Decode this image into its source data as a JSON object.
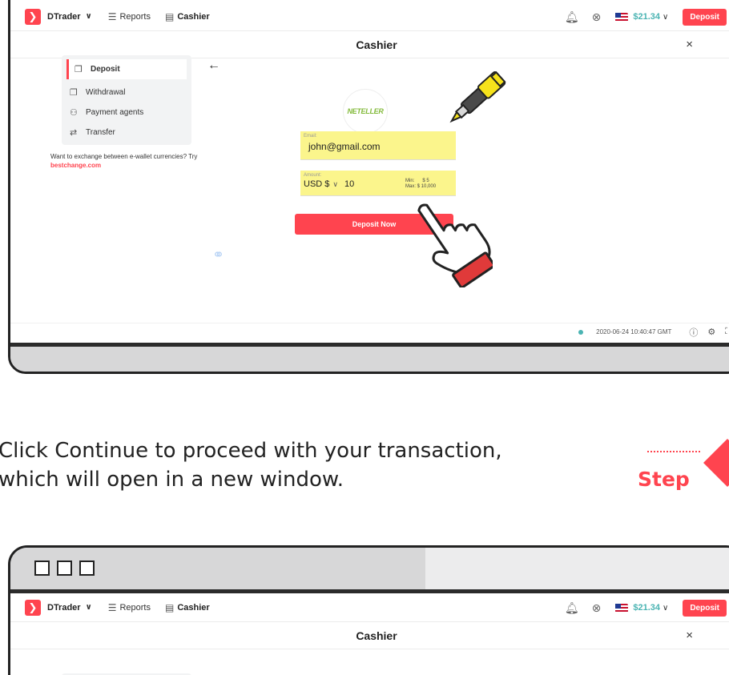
{
  "header": {
    "brand": "DTrader",
    "reports": "Reports",
    "cashier": "Cashier",
    "balance": "$21.34",
    "deposit": "Deposit",
    "chevron": "∨"
  },
  "cashier_title": "Cashier",
  "close": "×",
  "sidebar": {
    "items": [
      {
        "label": "Deposit",
        "icon": "deposit-icon"
      },
      {
        "label": "Withdrawal",
        "icon": "withdrawal-icon"
      },
      {
        "label": "Payment agents",
        "icon": "payment-agents-icon"
      },
      {
        "label": "Transfer",
        "icon": "transfer-icon"
      }
    ],
    "note_prefix": "Want to exchange between e-wallet currencies? Try ",
    "note_link": "bestchange.com"
  },
  "form": {
    "provider_logo": "NETELLER",
    "email_label": "Email:",
    "email_value": "john@gmail.com",
    "amount_label": "Amount:",
    "currency": "USD $",
    "amount_value": "10",
    "min": "Min:      $ 5",
    "max": "Max: $ 10,000",
    "submit": "Deposit Now"
  },
  "footer": {
    "timestamp": "2020-06-24 10:40:47 GMT"
  },
  "instruction": {
    "line1": "Click Continue to proceed with your transaction,",
    "line2": "which will open in a new window.",
    "step_label": "Step"
  },
  "colors": {
    "accent": "#ff444f",
    "teal": "#4bb4b3",
    "highlight": "#fbf58c"
  }
}
